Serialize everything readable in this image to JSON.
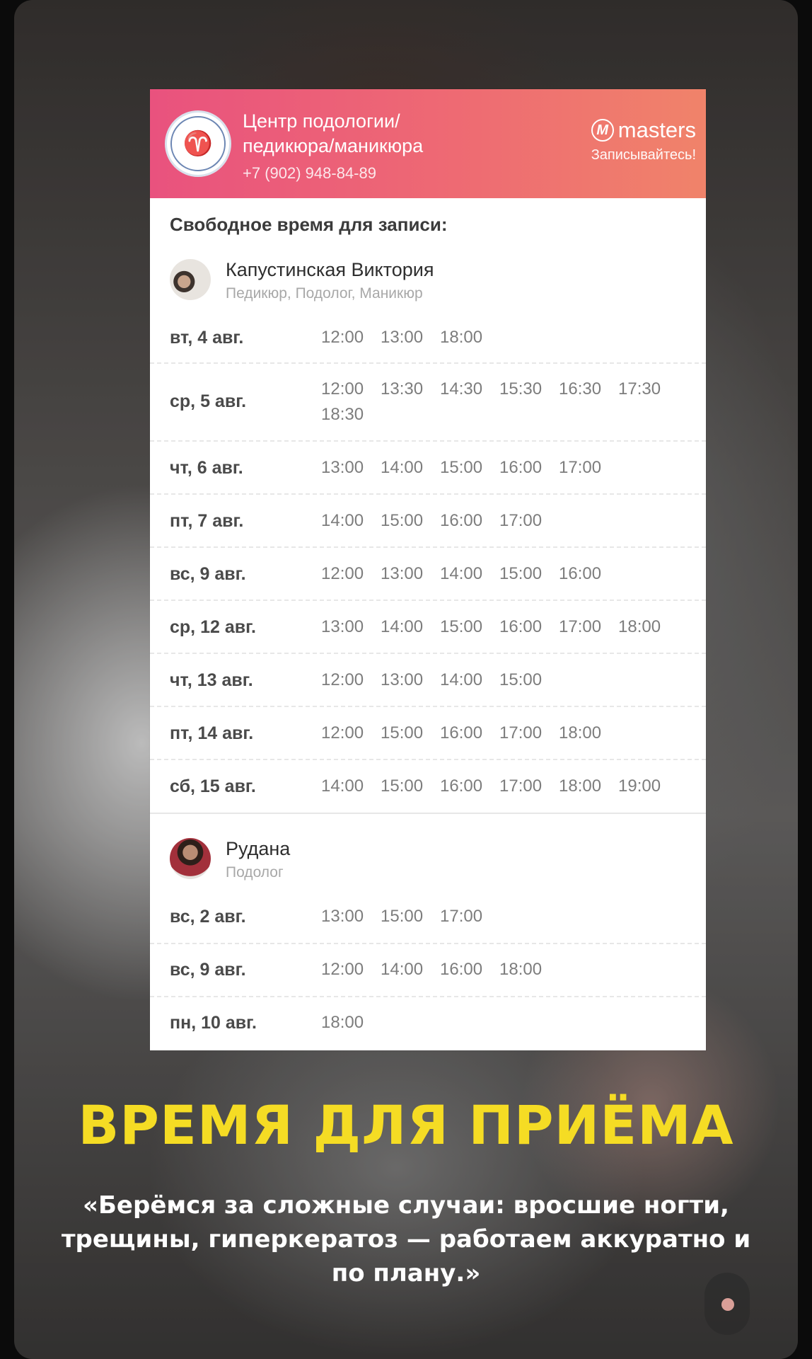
{
  "header": {
    "title": "Центр подологии/ педикюра/маникюра",
    "phone": "+7 (902) 948-84-89",
    "brand_name": "masters",
    "brand_cta": "Записывайтесь!",
    "gradient_start": "#e9527e",
    "gradient_end": "#f0836a"
  },
  "section_title": "Свободное время для записи:",
  "masters": [
    {
      "name": "Капустинская Виктория",
      "role": "Педикюр, Подолог, Маникюр",
      "days": [
        {
          "day": "вт, 4 авг.",
          "slots": [
            "12:00",
            "13:00",
            "18:00"
          ]
        },
        {
          "day": "ср, 5 авг.",
          "slots": [
            "12:00",
            "13:30",
            "14:30",
            "15:30",
            "16:30",
            "17:30",
            "18:30"
          ]
        },
        {
          "day": "чт, 6 авг.",
          "slots": [
            "13:00",
            "14:00",
            "15:00",
            "16:00",
            "17:00"
          ]
        },
        {
          "day": "пт, 7 авг.",
          "slots": [
            "14:00",
            "15:00",
            "16:00",
            "17:00"
          ]
        },
        {
          "day": "вс, 9 авг.",
          "slots": [
            "12:00",
            "13:00",
            "14:00",
            "15:00",
            "16:00"
          ]
        },
        {
          "day": "ср, 12 авг.",
          "slots": [
            "13:00",
            "14:00",
            "15:00",
            "16:00",
            "17:00",
            "18:00"
          ]
        },
        {
          "day": "чт, 13 авг.",
          "slots": [
            "12:00",
            "13:00",
            "14:00",
            "15:00"
          ]
        },
        {
          "day": "пт, 14 авг.",
          "slots": [
            "12:00",
            "15:00",
            "16:00",
            "17:00",
            "18:00"
          ]
        },
        {
          "day": "сб, 15 авг.",
          "slots": [
            "14:00",
            "15:00",
            "16:00",
            "17:00",
            "18:00",
            "19:00"
          ]
        }
      ]
    },
    {
      "name": "Рудана",
      "role": "Подолог",
      "days": [
        {
          "day": "вс, 2 авг.",
          "slots": [
            "13:00",
            "15:00",
            "17:00"
          ]
        },
        {
          "day": "вс, 9 авг.",
          "slots": [
            "12:00",
            "14:00",
            "16:00",
            "18:00"
          ]
        },
        {
          "day": "пн, 10 авг.",
          "slots": [
            "18:00"
          ]
        }
      ]
    }
  ],
  "caption": {
    "title": "ВРЕМЯ ДЛЯ ПРИЁМА",
    "quote": "«Берёмся за сложные случаи: вросшие ногти, трещины, гиперкератоз — работаем аккуратно и по плану.»",
    "title_color": "#f5dc24"
  }
}
